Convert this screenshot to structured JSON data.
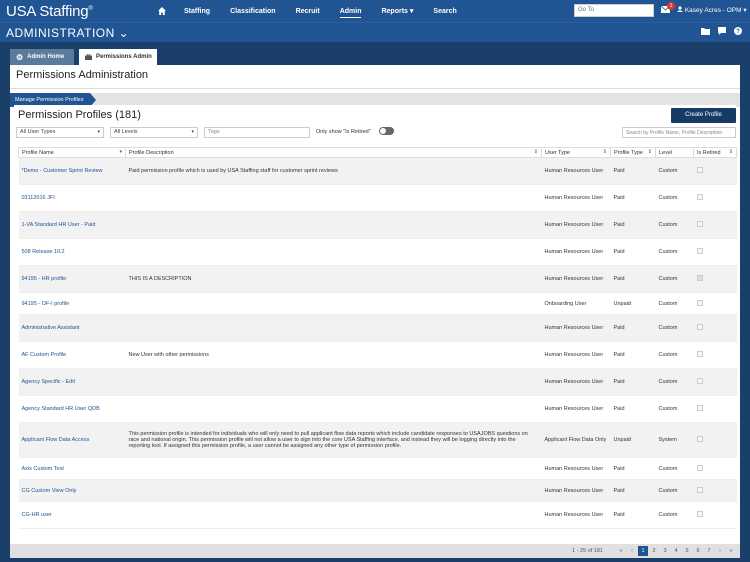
{
  "brand": {
    "name": "USA Staffing",
    "reg": "®"
  },
  "nav": {
    "items": [
      "Staffing",
      "Classification",
      "Recruit",
      "Admin",
      "Reports",
      "Search"
    ],
    "reports_caret": "▾"
  },
  "goto": {
    "placeholder": "Go To"
  },
  "notifications": {
    "count": "1"
  },
  "user": {
    "name": "Kasey Acres - OPM",
    "caret": "▾"
  },
  "admin": {
    "title": "ADMINISTRATION",
    "caret": "⌄"
  },
  "tabs": {
    "home": "Admin Home",
    "perm": "Permissions Admin"
  },
  "page": {
    "title": "Permissions Administration",
    "breadcrumb": "Manage Permission Profiles"
  },
  "profiles": {
    "title": "Permission Profiles (181)",
    "create_label": "Create Profile",
    "filters": {
      "user_types": "All User Types",
      "levels": "All Levels",
      "tags_placeholder": "Tags",
      "retired_label": "Only show \"Is Retired\"",
      "search_placeholder": "Search by Profile Name, Profile Description"
    },
    "columns": [
      "Profile Name",
      "Profile Description",
      "User Type",
      "Profile Type",
      "Level",
      "Is Retired"
    ],
    "rows": [
      {
        "name": "*Demo - Customer Sprint Review",
        "desc": "Paid permission profile which is used by USA Staffing staff for customer sprint reviews",
        "user_type": "Human Resources User",
        "ptype": "Paid",
        "level": "Custom",
        "retired": false
      },
      {
        "name": "03112016 JFI",
        "desc": "",
        "user_type": "Human Resources User",
        "ptype": "Paid",
        "level": "Custom",
        "retired": false
      },
      {
        "name": "1-VA Standard HR User - Paid",
        "desc": "",
        "user_type": "Human Resources User",
        "ptype": "Paid",
        "level": "Custom",
        "retired": false
      },
      {
        "name": "508 Release 10.2",
        "desc": "",
        "user_type": "Human Resources User",
        "ptype": "Paid",
        "level": "Custom",
        "retired": false
      },
      {
        "name": "94195 - HR profile",
        "desc": "THIS IS A DESCRIPTION",
        "user_type": "Human Resources User",
        "ptype": "Paid",
        "level": "Custom",
        "retired": true
      },
      {
        "name": "94195 - OF-I profile",
        "desc": "",
        "user_type": "Onboarding User",
        "ptype": "Unpaid",
        "level": "Custom",
        "retired": false
      },
      {
        "name": "Administrative Assistant",
        "desc": "",
        "user_type": "Human Resources User",
        "ptype": "Paid",
        "level": "Custom",
        "retired": false
      },
      {
        "name": "AF Custom Profile",
        "desc": "New User with other permissions",
        "user_type": "Human Resources User",
        "ptype": "Paid",
        "level": "Custom",
        "retired": false
      },
      {
        "name": "Agency Specific - Edit",
        "desc": "",
        "user_type": "Human Resources User",
        "ptype": "Paid",
        "level": "Custom",
        "retired": false
      },
      {
        "name": "Agency Standard HR User QDB",
        "desc": "",
        "user_type": "Human Resources User",
        "ptype": "Paid",
        "level": "Custom",
        "retired": false
      },
      {
        "name": "Applicant Flow Data Access",
        "desc": "This permission profile is intended for individuals who will only need to pull applicant flow data reports which include candidate responses to USAJOBS questions on race and national origin. This permission profile will not allow a user to sign into the core USA Staffing interface, and instead they will be logging directly into the reporting tool. If assigned this permission profile, a user cannot be assigned any other type of permission profile.",
        "user_type": "Applicant Flow Data Only",
        "ptype": "Unpaid",
        "level": "System",
        "retired": false
      },
      {
        "name": "Axis Custom Test",
        "desc": "",
        "user_type": "Human Resources User",
        "ptype": "Paid",
        "level": "Custom",
        "retired": false
      },
      {
        "name": "CG Custom View Only",
        "desc": "",
        "user_type": "Human Resources User",
        "ptype": "Paid",
        "level": "Custom",
        "retired": false
      },
      {
        "name": "CG-HR user",
        "desc": "",
        "user_type": "Human Resources User",
        "ptype": "Paid",
        "level": "Custom",
        "retired": false
      }
    ]
  },
  "pager": {
    "info": "1 - 25 of 181",
    "pages": [
      "1",
      "2",
      "3",
      "4",
      "5",
      "6",
      "7"
    ],
    "current": "1",
    "first": "«",
    "prev": "‹",
    "next": "›",
    "last": "»"
  },
  "icons": {
    "home": "home-icon",
    "mail": "envelope-icon",
    "user": "user-icon",
    "folder": "folder-icon",
    "chat": "chat-icon",
    "help": "help-icon",
    "gear": "gear-icon",
    "briefcase": "briefcase-icon"
  }
}
